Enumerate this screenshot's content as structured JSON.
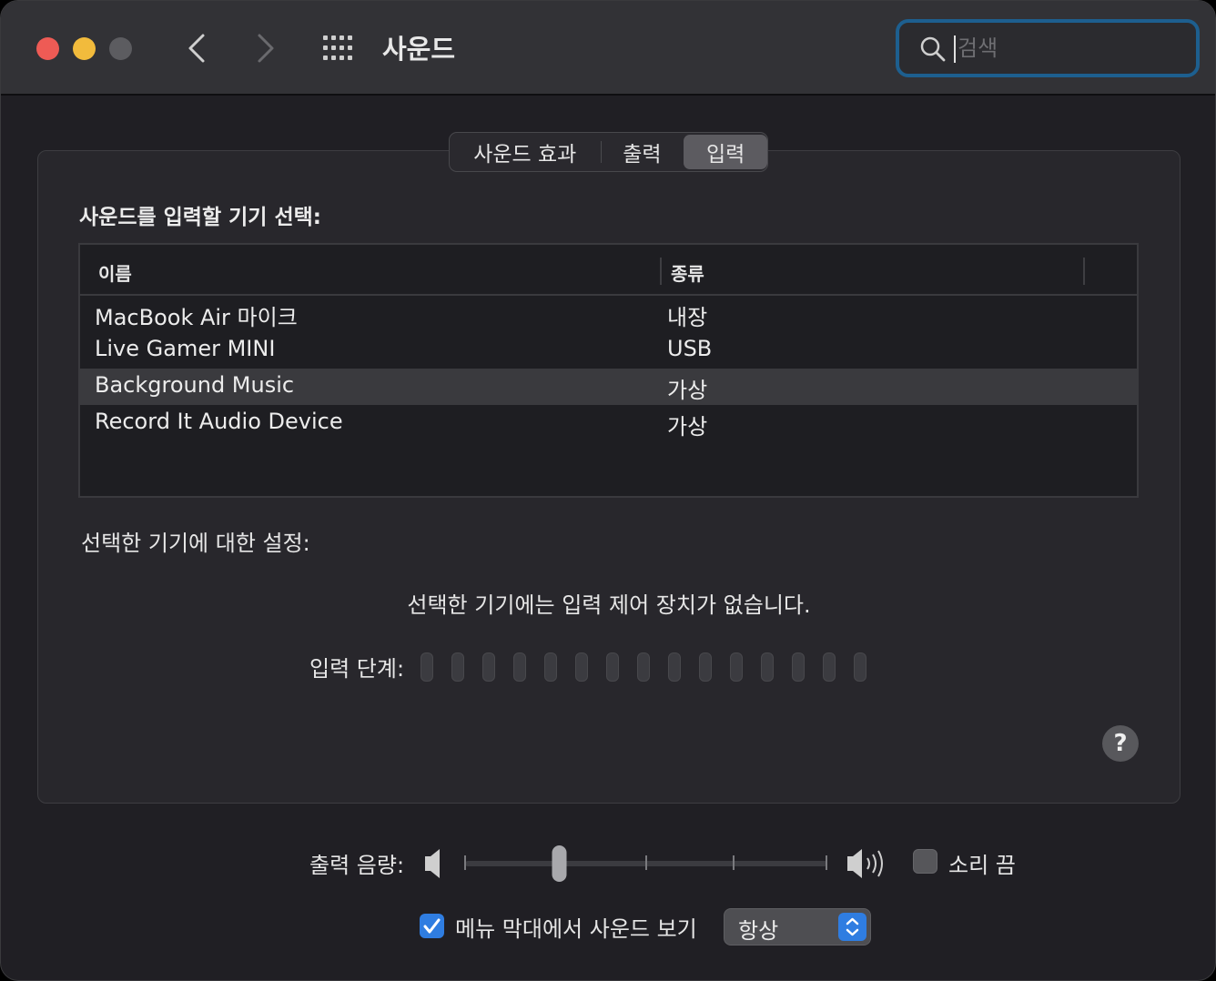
{
  "window": {
    "title": "사운드"
  },
  "search": {
    "placeholder": "검색",
    "value": ""
  },
  "tabs": [
    {
      "label": "사운드 효과",
      "selected": false
    },
    {
      "label": "출력",
      "selected": false
    },
    {
      "label": "입력",
      "selected": true
    }
  ],
  "input_section": {
    "title": "사운드를 입력할 기기 선택:",
    "columns": [
      "이름",
      "종류"
    ],
    "devices": [
      {
        "name": "MacBook Air 마이크",
        "kind": "내장",
        "selected": false
      },
      {
        "name": "Live Gamer MINI",
        "kind": "USB",
        "selected": false
      },
      {
        "name": "Background Music",
        "kind": "가상",
        "selected": true
      },
      {
        "name": "Record It Audio Device",
        "kind": "가상",
        "selected": false
      }
    ]
  },
  "device_settings": {
    "title": "선택한 기기에 대한 설정:",
    "message": "선택한 기기에는 입력 제어 장치가 없습니다.",
    "level_label": "입력 단계:",
    "level_segments": 15,
    "level_active": 0
  },
  "help": {
    "label": "?"
  },
  "output_volume": {
    "label": "출력 음량:",
    "value": 0.26,
    "mute_label": "소리 끔",
    "muted": false
  },
  "menu_bar": {
    "label": "메뉴 막대에서 사운드 보기",
    "checked": true,
    "option": "항상"
  },
  "colors": {
    "accent": "#2f7de1",
    "close": "#ee5b55",
    "minimize": "#f2bb3c",
    "zoom_inactive": "#5c5c60",
    "search_focus": "#1d5f8f"
  }
}
